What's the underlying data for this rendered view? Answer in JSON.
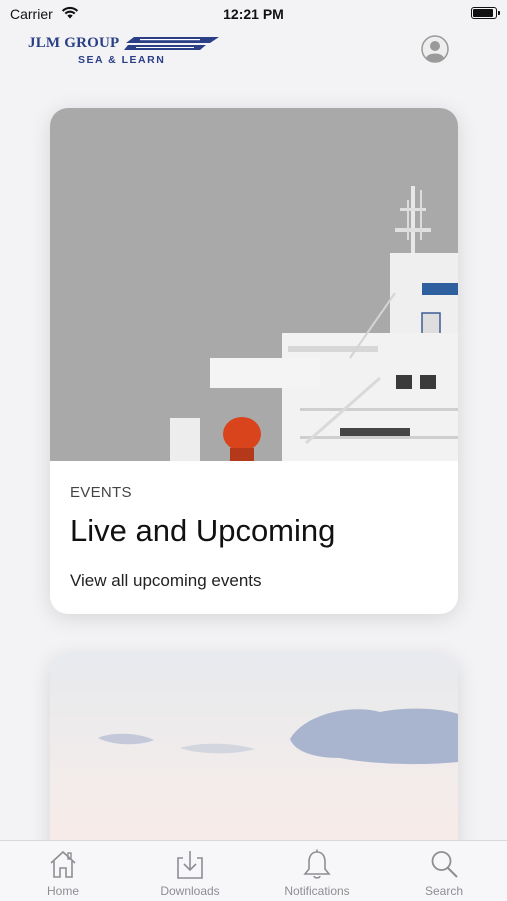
{
  "status_bar": {
    "carrier": "Carrier",
    "time": "12:21 PM",
    "battery_level": 1.0
  },
  "header": {
    "logo_main": "JLM GROUP",
    "logo_sub": "SEA & LEARN",
    "profile_icon": "person-circle-icon"
  },
  "cards": [
    {
      "eyebrow": "EVENTS",
      "title": "Live and Upcoming",
      "subtitle": "View all upcoming events",
      "image": "ship-photo"
    },
    {
      "image": "sky-photo"
    }
  ],
  "tab_bar": {
    "items": [
      {
        "label": "Home",
        "icon": "house-icon"
      },
      {
        "label": "Downloads",
        "icon": "download-tray-icon"
      },
      {
        "label": "Notifications",
        "icon": "bell-icon"
      },
      {
        "label": "Search",
        "icon": "magnifier-icon"
      }
    ]
  },
  "colors": {
    "brand": "#2a3f86",
    "tab_inactive": "#8e8e93",
    "background": "#f3f3f5"
  }
}
